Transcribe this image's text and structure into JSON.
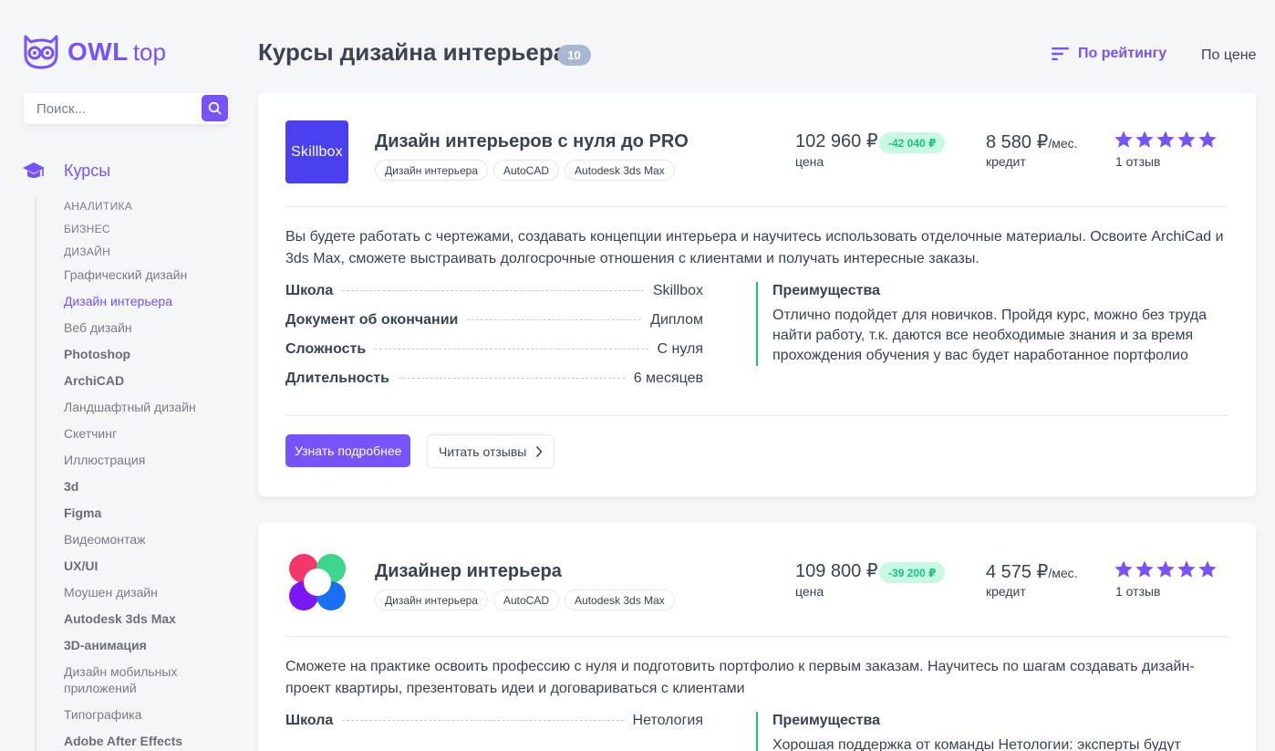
{
  "sidebar": {
    "logo": {
      "owl": "OWL",
      "top": "top"
    },
    "search": {
      "placeholder": "Поиск..."
    },
    "first_level": "Курсы",
    "items": [
      {
        "label": "АНАЛИТИКА",
        "style": "caps"
      },
      {
        "label": "БИЗНЕС",
        "style": "caps"
      },
      {
        "label": "ДИЗАЙН",
        "style": "caps"
      },
      {
        "label": "Графический дизайн",
        "style": "normal"
      },
      {
        "label": "Дизайн интерьера",
        "style": "active"
      },
      {
        "label": "Веб дизайн",
        "style": "normal"
      },
      {
        "label": "Photoshop",
        "style": "bold"
      },
      {
        "label": "ArchiCAD",
        "style": "bold"
      },
      {
        "label": "Ландшафтный дизайн",
        "style": "normal"
      },
      {
        "label": "Скетчинг",
        "style": "normal"
      },
      {
        "label": "Иллюстрация",
        "style": "normal"
      },
      {
        "label": "3d",
        "style": "bold"
      },
      {
        "label": "Figma",
        "style": "bold"
      },
      {
        "label": "Видеомонтаж",
        "style": "normal"
      },
      {
        "label": "UX/UI",
        "style": "bold"
      },
      {
        "label": "Моушен дизайн",
        "style": "normal"
      },
      {
        "label": "Autodesk 3ds Max",
        "style": "bold"
      },
      {
        "label": "3D-анимация",
        "style": "bold"
      },
      {
        "label": "Дизайн мобильных приложений",
        "style": "normal"
      },
      {
        "label": "Типографика",
        "style": "normal"
      },
      {
        "label": "Adobe After Effects",
        "style": "bold"
      }
    ]
  },
  "header": {
    "title": "Курсы дизайна интерьера",
    "count": "10",
    "sort_rating": "По рейтингу",
    "sort_price": "По цене"
  },
  "courses": [
    {
      "logo_text": "Skillbox",
      "title": "Дизайн интерьеров с нуля до PRO",
      "tags": [
        "Дизайн интерьера",
        "AutoCAD",
        "Autodesk 3ds Max"
      ],
      "price": "102 960 ₽",
      "discount": "-42 040 ₽",
      "price_label": "цена",
      "credit": "8 580 ₽",
      "credit_per": "/мес.",
      "credit_label": "кредит",
      "rating": 5,
      "reviews": "1 отзыв",
      "description": "Вы будете работать с чертежами, создавать концепции интерьера и научитесь использовать отделочные материалы. Освоите ArchiCad и 3ds Max, сможете выстраивать долгосрочные отношения с клиентами и получать интересные заказы.",
      "features": [
        {
          "name": "Школа",
          "value": "Skillbox"
        },
        {
          "name": "Документ об окончании",
          "value": "Диплом"
        },
        {
          "name": "Сложность",
          "value": "С нуля"
        },
        {
          "name": "Длительность",
          "value": "6 месяцев"
        }
      ],
      "advantages_title": "Преимущества",
      "advantages_text": "Отлично подойдет для новичков. Пройдя курс, можно без труда найти работу, т.к. даются все необходимые знания и за время прохождения обучения у вас будет наработанное портфолио",
      "btn_more": "Узнать подробнее",
      "btn_reviews": "Читать отзывы"
    },
    {
      "title": "Дизайнер интерьера",
      "tags": [
        "Дизайн интерьера",
        "AutoCAD",
        "Autodesk 3ds Max"
      ],
      "price": "109 800 ₽",
      "discount": "-39 200 ₽",
      "price_label": "цена",
      "credit": "4 575 ₽",
      "credit_per": "/мес.",
      "credit_label": "кредит",
      "rating": 5,
      "reviews": "1 отзыв",
      "description": "Сможете на практике освоить профессию с нуля и подготовить портфолио к первым заказам. Научитесь по шагам создавать дизайн-проект квартиры, презентовать идеи и договариваться с клиентами",
      "features": [
        {
          "name": "Школа",
          "value": "Нетология"
        }
      ],
      "advantages_title": "Преимущества",
      "advantages_text": "Хорошая поддержка от команды Нетологии: эксперты будут изучать"
    }
  ],
  "colors": {
    "accent": "#7653FC",
    "text": "#3B434E",
    "muted": "#787D85",
    "green": "#1CC37E",
    "green_bg": "#C8F8E4",
    "badge_gray": "#AAB7D1",
    "background": "#F5F6F8"
  }
}
